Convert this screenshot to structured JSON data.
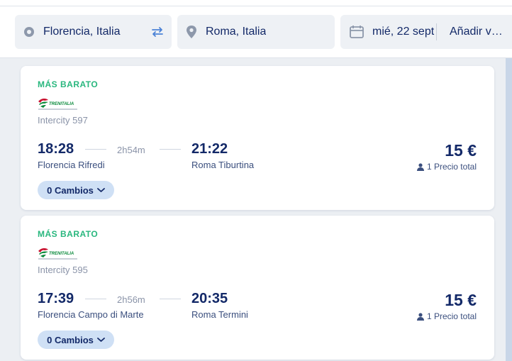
{
  "search": {
    "origin": "Florencia, Italia",
    "destination": "Roma, Italia",
    "date": "mié, 22 sept",
    "return_label": "Añadir vu..."
  },
  "results": [
    {
      "badge": "MÁS BARATO",
      "operator": "TRENITALIA",
      "train": "Intercity 597",
      "dep_time": "18:28",
      "duration": "2h54m",
      "arr_time": "21:22",
      "dep_station": "Florencia Rifredi",
      "arr_station": "Roma Tiburtina",
      "price": "15 €",
      "price_note": "1 Precio total",
      "changes": "0 Cambios"
    },
    {
      "badge": "MÁS BARATO",
      "operator": "TRENITALIA",
      "train": "Intercity 595",
      "dep_time": "17:39",
      "duration": "2h56m",
      "arr_time": "20:35",
      "dep_station": "Florencia Campo di Marte",
      "arr_station": "Roma Termini",
      "price": "15 €",
      "price_note": "1 Precio total",
      "changes": "0 Cambios"
    }
  ],
  "colors": {
    "accent": "#29b77e",
    "primary_text": "#132968",
    "chip_bg": "#cfe0f5",
    "field_bg": "#eef1f5",
    "swap_icon": "#4b82d6"
  },
  "icons": {
    "origin": "origin-circle-icon",
    "swap": "swap-arrows-icon",
    "destination": "location-pin-icon",
    "date": "calendar-icon",
    "passenger": "person-icon",
    "chevron": "chevron-down-icon"
  }
}
